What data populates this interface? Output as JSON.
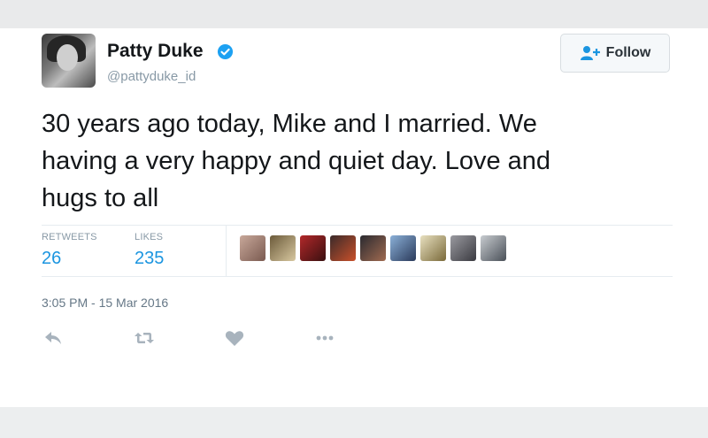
{
  "tweet": {
    "author_name": "Patty Duke",
    "author_handle": "@pattyduke_id",
    "follow_label": "Follow",
    "text": "30 years ago today, Mike and I married. We\nhaving a very happy and quiet day.  Love and\nhugs to all",
    "stats": {
      "retweets_label": "RETWEETS",
      "retweets_count": "26",
      "likes_label": "LIKES",
      "likes_count": "235"
    },
    "timestamp": "3:05 PM - 15 Mar 2016"
  },
  "colors": {
    "accent": "#1b95e0",
    "verified": "#1da1f2",
    "muted": "#8899a6"
  },
  "icons": [
    "verified-badge-icon",
    "follow-person-icon",
    "reply-icon",
    "retweet-icon",
    "like-icon",
    "more-icon"
  ],
  "likers": [
    {
      "color_a": "#c8a89a",
      "color_b": "#7a5a50"
    },
    {
      "color_a": "#6b5a3a",
      "color_b": "#d8c8a0"
    },
    {
      "color_a": "#b2282a",
      "color_b": "#3a1010"
    },
    {
      "color_a": "#3a2a2a",
      "color_b": "#c9502a"
    },
    {
      "color_a": "#2a2a30",
      "color_b": "#a06a50"
    },
    {
      "color_a": "#8bb0d8",
      "color_b": "#2a3a5a"
    },
    {
      "color_a": "#e8e0c0",
      "color_b": "#7a6a3a"
    },
    {
      "color_a": "#9a9aa0",
      "color_b": "#3a3a40"
    },
    {
      "color_a": "#c8ccd0",
      "color_b": "#4a5058"
    }
  ]
}
